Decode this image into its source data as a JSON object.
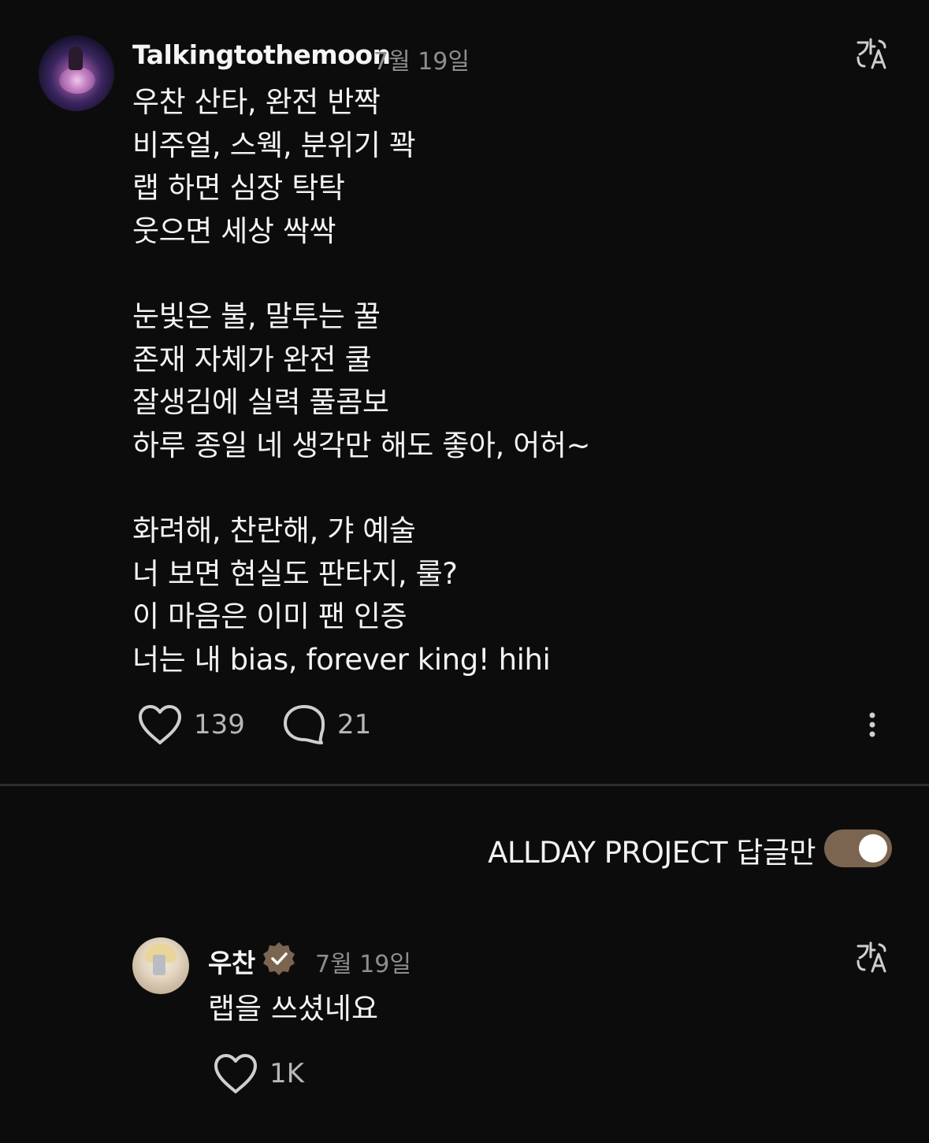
{
  "post": {
    "username": "Talkingtothemoon",
    "date": "7월 19일",
    "lines": [
      "우찬 산타, 완전 반짝",
      "비주얼, 스웩, 분위기 꽉",
      "랩 하면 심장 탁탁",
      "웃으면 세상 싹싹",
      "",
      "눈빛은 불, 말투는 꿀",
      "존재 자체가 완전 쿨",
      "잘생김에 실력 풀콤보",
      "하루 종일 네 생각만 해도 좋아, 어허~",
      "",
      "화려해, 찬란해, 갸 예술",
      "너 보면 현실도 판타지, 룰?",
      "이 마음은 이미 팬 인증",
      "너는 내 bias, forever king! hihi"
    ],
    "likes": "139",
    "comments": "21"
  },
  "filter": {
    "label": "ALLDAY PROJECT 답글만",
    "enabled": true,
    "toggle_color": "#7b6551"
  },
  "reply": {
    "username": "우찬",
    "date": "7월 19일",
    "text": "랩을 쓰셨네요",
    "likes": "1K",
    "verified_color": "#7b6551"
  },
  "icons": {
    "translate": "translate-icon",
    "like": "heart-icon",
    "comment": "comment-bubble-icon",
    "more": "more-vertical-icon",
    "verified": "verified-badge-icon"
  }
}
